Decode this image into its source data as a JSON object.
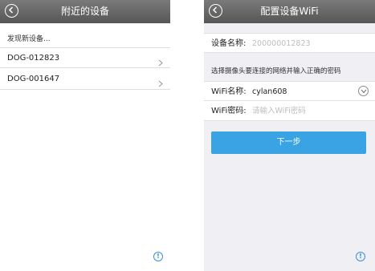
{
  "left_screen": {
    "title": "附近的设备",
    "hint": "发现新设备...",
    "devices": [
      {
        "name": "DOG-012823"
      },
      {
        "name": "DOG-001647"
      }
    ],
    "icons": {
      "back": "back-circle-icon",
      "chevron": "chevron-right-icon",
      "info": "info-icon"
    }
  },
  "right_screen": {
    "title": "配置设备WiFi",
    "device_name_label": "设备名称:",
    "device_name_value": "200000012823",
    "instruction": "选择摄像头要连接的网络并输入正确的密码",
    "wifi_name_label": "WiFi名称:",
    "wifi_name_value": "cylan608",
    "wifi_password_label": "WiFi密码:",
    "wifi_password_placeholder": "请输入WiFi密码",
    "next_button": "下一步",
    "icons": {
      "back": "back-circle-icon",
      "dropdown": "chevron-down-circle-icon",
      "info": "info-icon"
    }
  },
  "colors": {
    "navbar": "#666666",
    "primary_button": "#3aa3e3",
    "info_icon": "#3a8fd6",
    "right_background": "#efeff4"
  }
}
